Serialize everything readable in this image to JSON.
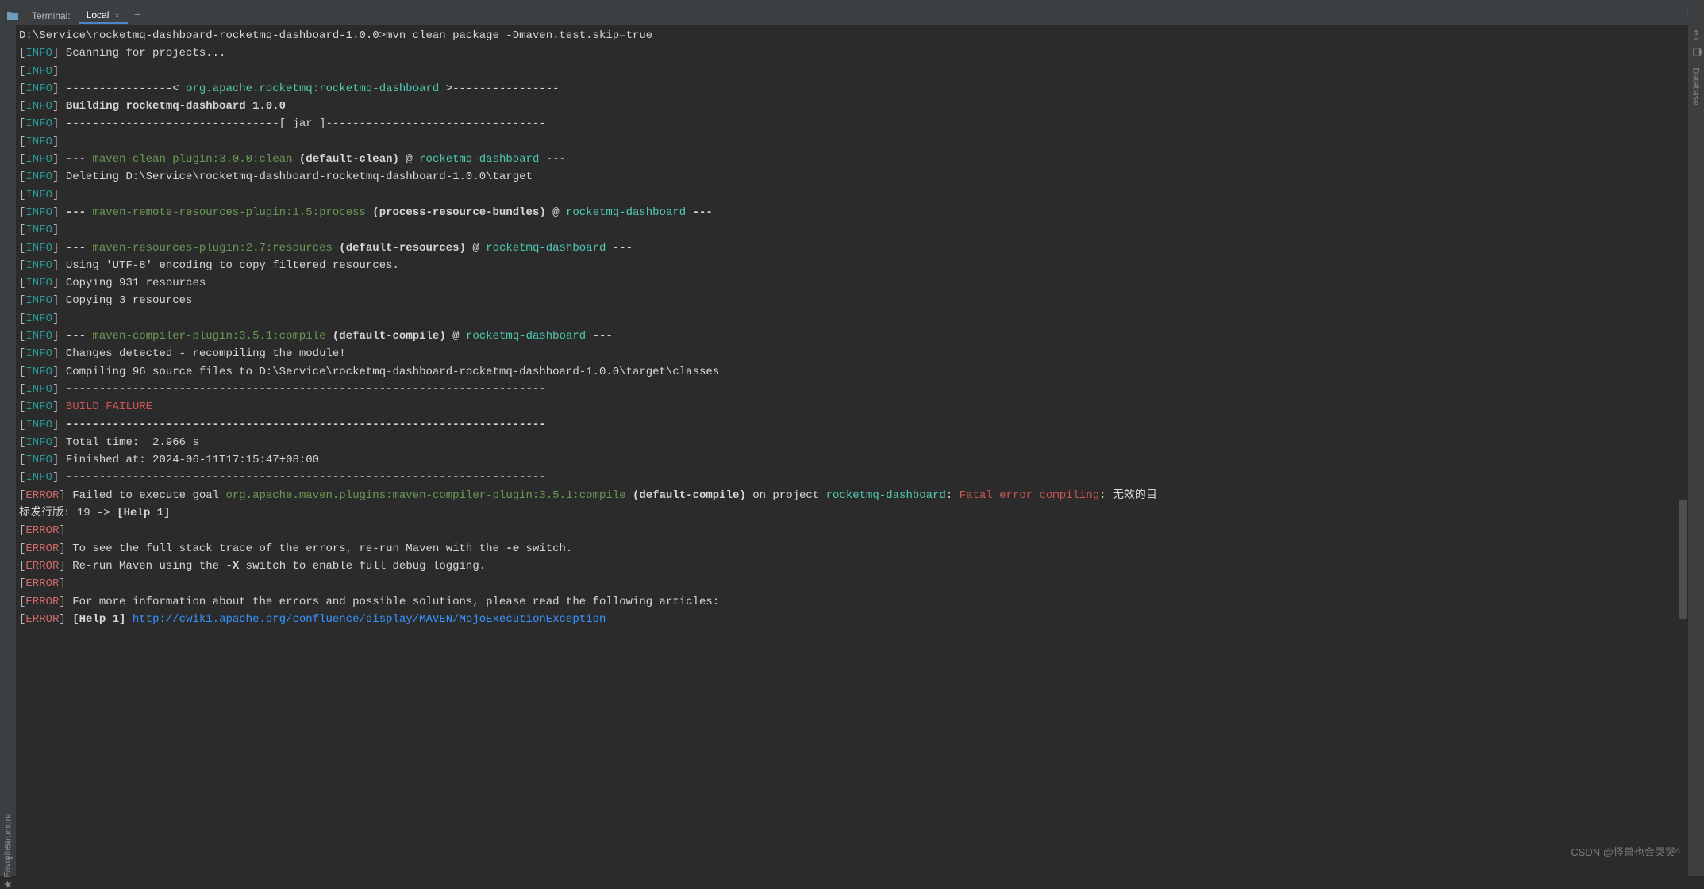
{
  "tabs": {
    "terminal": "Terminal:",
    "local": "Local",
    "add": "+"
  },
  "right_sidebar": {
    "maven": "en",
    "database": "Database"
  },
  "left_sidebar": {
    "structure": "Structure",
    "favorites": "Favorites"
  },
  "watermark": "CSDN @怪兽也会哭哭^",
  "prompt": "D:\\Service\\rocketmq-dashboard-rocketmq-dashboard-1.0.0>",
  "cmd": "mvn clean package -Dmaven.test.skip=true",
  "lines": [
    {
      "lvl": "INFO",
      "t": [
        [
          "w",
          "Scanning for projects..."
        ]
      ]
    },
    {
      "lvl": "INFO",
      "t": []
    },
    {
      "lvl": "INFO",
      "t": [
        [
          "w",
          "----------------< "
        ],
        [
          "c",
          "org.apache.rocketmq:rocketmq-dashboard"
        ],
        [
          "w",
          " >----------------"
        ]
      ]
    },
    {
      "lvl": "INFO",
      "t": [
        [
          "b",
          "Building rocketmq-dashboard 1.0.0"
        ]
      ]
    },
    {
      "lvl": "INFO",
      "t": [
        [
          "w",
          "--------------------------------[ jar ]---------------------------------"
        ]
      ]
    },
    {
      "lvl": "INFO",
      "t": []
    },
    {
      "lvl": "INFO",
      "t": [
        [
          "b",
          "--- "
        ],
        [
          "g",
          "maven-clean-plugin:3.0.0:clean"
        ],
        [
          "b",
          " (default-clean)"
        ],
        [
          "w",
          " @ "
        ],
        [
          "c",
          "rocketmq-dashboard"
        ],
        [
          "b",
          " ---"
        ]
      ]
    },
    {
      "lvl": "INFO",
      "t": [
        [
          "w",
          "Deleting D:\\Service\\rocketmq-dashboard-rocketmq-dashboard-1.0.0\\target"
        ]
      ]
    },
    {
      "lvl": "INFO",
      "t": []
    },
    {
      "lvl": "INFO",
      "t": [
        [
          "b",
          "--- "
        ],
        [
          "g",
          "maven-remote-resources-plugin:1.5:process"
        ],
        [
          "b",
          " (process-resource-bundles)"
        ],
        [
          "w",
          " @ "
        ],
        [
          "c",
          "rocketmq-dashboard"
        ],
        [
          "b",
          " ---"
        ]
      ]
    },
    {
      "lvl": "INFO",
      "t": []
    },
    {
      "lvl": "INFO",
      "t": [
        [
          "b",
          "--- "
        ],
        [
          "g",
          "maven-resources-plugin:2.7:resources"
        ],
        [
          "b",
          " (default-resources)"
        ],
        [
          "w",
          " @ "
        ],
        [
          "c",
          "rocketmq-dashboard"
        ],
        [
          "b",
          " ---"
        ]
      ]
    },
    {
      "lvl": "INFO",
      "t": [
        [
          "w",
          "Using 'UTF-8' encoding to copy filtered resources."
        ]
      ]
    },
    {
      "lvl": "INFO",
      "t": [
        [
          "w",
          "Copying 931 resources"
        ]
      ]
    },
    {
      "lvl": "INFO",
      "t": [
        [
          "w",
          "Copying 3 resources"
        ]
      ]
    },
    {
      "lvl": "INFO",
      "t": []
    },
    {
      "lvl": "INFO",
      "t": [
        [
          "b",
          "--- "
        ],
        [
          "g",
          "maven-compiler-plugin:3.5.1:compile"
        ],
        [
          "b",
          " (default-compile)"
        ],
        [
          "w",
          " @ "
        ],
        [
          "c",
          "rocketmq-dashboard"
        ],
        [
          "b",
          " ---"
        ]
      ]
    },
    {
      "lvl": "INFO",
      "t": [
        [
          "w",
          "Changes detected - recompiling the module!"
        ]
      ]
    },
    {
      "lvl": "INFO",
      "t": [
        [
          "w",
          "Compiling 96 source files to D:\\Service\\rocketmq-dashboard-rocketmq-dashboard-1.0.0\\target\\classes"
        ]
      ]
    },
    {
      "lvl": "INFO",
      "t": [
        [
          "b",
          "------------------------------------------------------------------------"
        ]
      ]
    },
    {
      "lvl": "INFO",
      "t": [
        [
          "r",
          "BUILD FAILURE"
        ]
      ]
    },
    {
      "lvl": "INFO",
      "t": [
        [
          "b",
          "------------------------------------------------------------------------"
        ]
      ]
    },
    {
      "lvl": "INFO",
      "t": [
        [
          "w",
          "Total time:  2.966 s"
        ]
      ]
    },
    {
      "lvl": "INFO",
      "t": [
        [
          "w",
          "Finished at: 2024-06-11T17:15:47+08:00"
        ]
      ]
    },
    {
      "lvl": "INFO",
      "t": [
        [
          "b",
          "------------------------------------------------------------------------"
        ]
      ]
    },
    {
      "lvl": "ERROR",
      "t": [
        [
          "w",
          "Failed to execute goal "
        ],
        [
          "g",
          "org.apache.maven.plugins:maven-compiler-plugin:3.5.1:compile"
        ],
        [
          "b",
          " (default-compile)"
        ],
        [
          "w",
          " on project "
        ],
        [
          "c",
          "rocketmq-dashboard"
        ],
        [
          "w",
          ": "
        ],
        [
          "r",
          "Fatal error compiling"
        ],
        [
          "w",
          ": 无效的目\n标发行版: 19 -> "
        ],
        [
          "b",
          "[Help 1]"
        ]
      ]
    },
    {
      "lvl": "ERROR",
      "t": []
    },
    {
      "lvl": "ERROR",
      "t": [
        [
          "w",
          "To see the full stack trace of the errors, re-run Maven with the "
        ],
        [
          "b",
          "-e"
        ],
        [
          "w",
          " switch."
        ]
      ]
    },
    {
      "lvl": "ERROR",
      "t": [
        [
          "w",
          "Re-run Maven using the "
        ],
        [
          "b",
          "-X"
        ],
        [
          "w",
          " switch to enable full debug logging."
        ]
      ]
    },
    {
      "lvl": "ERROR",
      "t": []
    },
    {
      "lvl": "ERROR",
      "t": [
        [
          "w",
          "For more information about the errors and possible solutions, please read the following articles:"
        ]
      ]
    },
    {
      "lvl": "ERROR",
      "t": [
        [
          "b",
          "[Help 1]"
        ],
        [
          "w",
          " "
        ],
        [
          "l",
          "http://cwiki.apache.org/confluence/display/MAVEN/MojoExecutionException"
        ]
      ]
    }
  ]
}
